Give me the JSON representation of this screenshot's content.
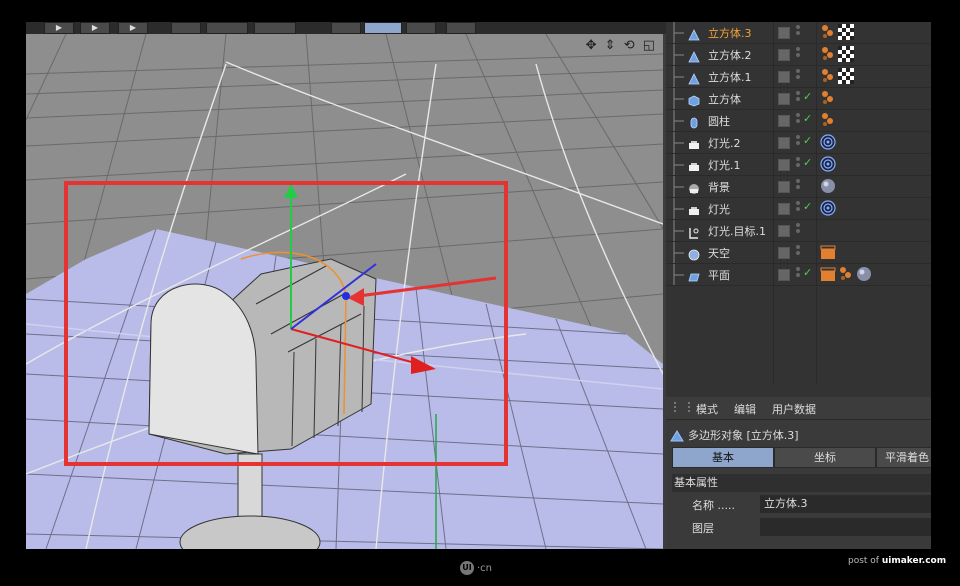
{
  "toolbar": {
    "buttons": [
      "▶",
      "▶",
      "▶"
    ]
  },
  "viewport": {
    "nav_icons": "✥ ⇕ ⟲ ◱"
  },
  "objects": [
    {
      "name": "立方体.3",
      "active": true,
      "icon": "cone-icon",
      "check": false,
      "tags": [
        "material-dots-icon",
        "checker-texture-icon"
      ]
    },
    {
      "name": "立方体.2",
      "active": false,
      "icon": "cone-icon",
      "check": false,
      "tags": [
        "material-dots-icon",
        "checker-texture-icon"
      ]
    },
    {
      "name": "立方体.1",
      "active": false,
      "icon": "cone-icon",
      "check": false,
      "tags": [
        "material-dots-icon",
        "checker-texture-icon"
      ]
    },
    {
      "name": "立方体",
      "active": false,
      "icon": "cube-icon",
      "check": true,
      "tags": [
        "material-dots-icon"
      ]
    },
    {
      "name": "圆柱",
      "active": false,
      "icon": "cylinder-icon",
      "check": true,
      "tags": [
        "material-dots-icon"
      ]
    },
    {
      "name": "灯光.2",
      "active": false,
      "icon": "light-icon",
      "check": true,
      "tags": [
        "target-tag-icon"
      ]
    },
    {
      "name": "灯光.1",
      "active": false,
      "icon": "light-icon",
      "check": true,
      "tags": [
        "target-tag-icon"
      ]
    },
    {
      "name": "背景",
      "active": false,
      "icon": "background-icon",
      "check": false,
      "tags": [
        "sphere-material-icon"
      ]
    },
    {
      "name": "灯光",
      "active": false,
      "icon": "light-icon",
      "check": true,
      "tags": [
        "target-tag-icon"
      ]
    },
    {
      "name": "灯光.目标.1",
      "active": false,
      "icon": "target-null-icon",
      "check": false,
      "tags": []
    },
    {
      "name": "天空",
      "active": false,
      "icon": "sky-icon",
      "check": false,
      "tags": [
        "clapper-tag-icon"
      ]
    },
    {
      "name": "平面",
      "active": false,
      "icon": "plane-icon",
      "check": true,
      "tags": [
        "clapper-tag-icon",
        "material-dots-icon",
        "sphere-material-icon"
      ]
    }
  ],
  "attributes": {
    "menu": [
      "模式",
      "编辑",
      "用户数据"
    ],
    "object_title": "多边形对象 [立方体.3]",
    "tabs": [
      "基本",
      "坐标",
      "平滑着色"
    ],
    "section_title": "基本属性",
    "name_label": "名称 .....",
    "name_value": "立方体.3",
    "layer_label": "图层"
  },
  "footer": {
    "watermark_prefix": "post of ",
    "watermark_site": "uimaker.com",
    "logo_badge": "UI",
    "logo_text": "·cn"
  },
  "colors": {
    "highlight_box": "#e53333",
    "active_object": "#f2a33a",
    "active_tab": "#8fa6cc",
    "check": "#4fd14f"
  }
}
